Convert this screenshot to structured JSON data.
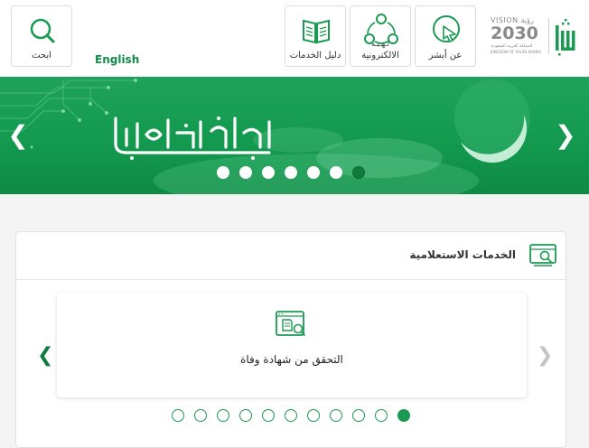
{
  "header": {
    "search_label": "ابحث",
    "language_link": "English",
    "services_guide_label": "دليل الخدمات",
    "eservices_label": "الالكترونية",
    "eservices_overflow_text": "اـهـيـه",
    "about_label": "عن أبشر",
    "vision_logo": {
      "top": "VISION رؤية",
      "year": "2030",
      "arabic_line": "المملكة العربية السعودية",
      "english_line": "KINGDOM OF SAUDI ARABIA"
    },
    "logo_name": "absher-logo",
    "logo_text": "أبشر"
  },
  "banner": {
    "greeting": "رمضان مبارك",
    "slide_count": 7,
    "active_slide": 7
  },
  "inquiry_section": {
    "title": "الخدمات الاستعلامية",
    "current_service": "التحقق من شهادة وفاة",
    "slide_count": 11,
    "active_slide": 11
  },
  "colors": {
    "brand_green": "#108c45",
    "banner_green": "#139a4f",
    "dot_active_dark": "#0e7a3c"
  }
}
